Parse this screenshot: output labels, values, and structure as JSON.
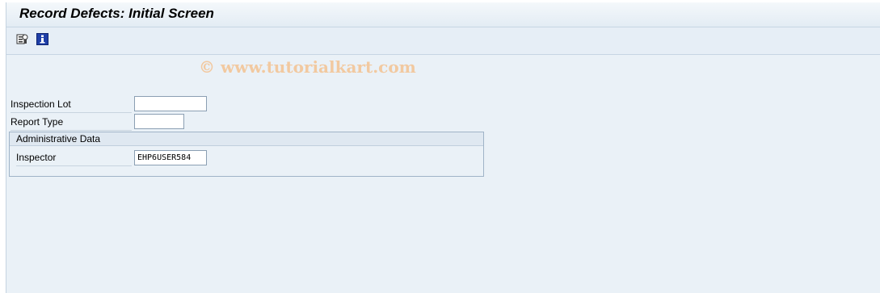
{
  "window": {
    "title": "Record Defects: Initial Screen"
  },
  "toolbar": {
    "icons": [
      "multiple-selection-icon",
      "info-icon"
    ],
    "watermark": "© www.tutorialkart.com"
  },
  "form": {
    "inspection_lot": {
      "label": "Inspection Lot",
      "value": ""
    },
    "report_type": {
      "label": "Report Type",
      "value": ""
    }
  },
  "admin": {
    "title": "Administrative Data",
    "inspector": {
      "label": "Inspector",
      "value": "EHP6USER584"
    }
  },
  "colors": {
    "background": "#eaf1f7",
    "toolbar": "#e6eef6",
    "info_icon": "#1f3fa8",
    "watermark": "#f2c9a0"
  }
}
